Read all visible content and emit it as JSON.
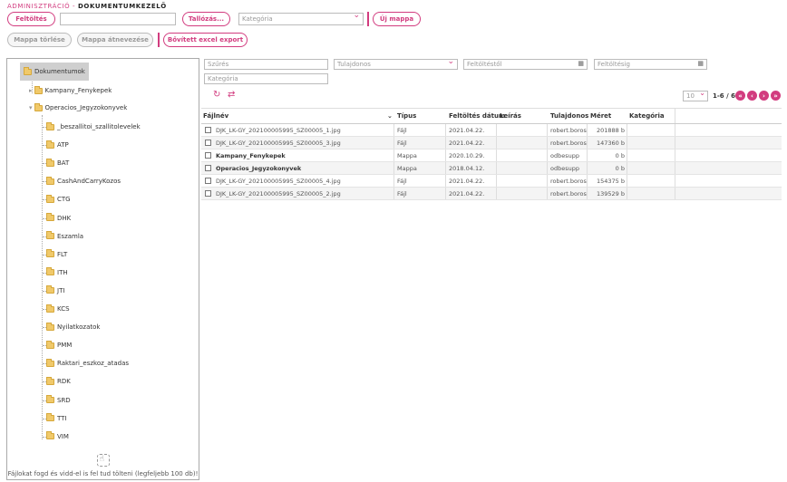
{
  "breadcrumb": {
    "section": "ADMINISZTRÁCIÓ",
    "sep": " - ",
    "page": "DOKUMENTUMKEZELŐ"
  },
  "toolbar": {
    "upload_label": "Feltöltés",
    "browse_label": "Tallózás...",
    "category_placeholder": "Kategória",
    "new_folder_label": "Új mappa",
    "delete_folder_label": "Mappa törlése",
    "rename_folder_label": "Mappa átnevezése",
    "excel_export_label": "Bővített excel export"
  },
  "filters": {
    "search_placeholder": "Szűrés",
    "owner_placeholder": "Tulajdonos",
    "upload_from_placeholder": "Feltöltéstől",
    "upload_to_placeholder": "Feltöltésig",
    "category_placeholder": "Kategória"
  },
  "tree": {
    "root": "Dokumentumok",
    "level1": [
      "Kampany_Fenykepek",
      "Operacios_Jegyzokonyvek"
    ],
    "children": [
      "_beszallitoi_szallitolevelek",
      "ATP",
      "BAT",
      "CashAndCarryKozos",
      "CTG",
      "DHK",
      "Eszamla",
      "FLT",
      "ITH",
      "JTI",
      "KCS",
      "Nyilatkozatok",
      "PMM",
      "Raktari_eszkoz_atadas",
      "RDK",
      "SRD",
      "TTI",
      "VIM"
    ],
    "drop_hint": "Fájlokat fogd és vidd-el is fel tud tölteni (legfeljebb 100 db)!"
  },
  "pager": {
    "page_size": "10",
    "range": "1-6 / 6"
  },
  "grid": {
    "columns": {
      "name": "Fájlnév",
      "type": "Típus",
      "date": "Feltöltés dátum",
      "desc": "Leírás",
      "owner": "Tulajdonos",
      "size": "Méret",
      "category": "Kategória"
    },
    "rows": [
      {
        "name": "DJK_LK-GY_202100005995_SZ00005_1.jpg",
        "type": "Fájl",
        "date": "2021.04.22.",
        "desc": "",
        "owner": "robert.boros",
        "size": "201888 b",
        "category": "",
        "folder": false
      },
      {
        "name": "DJK_LK-GY_202100005995_SZ00005_3.jpg",
        "type": "Fájl",
        "date": "2021.04.22.",
        "desc": "",
        "owner": "robert.boros",
        "size": "147360 b",
        "category": "",
        "folder": false
      },
      {
        "name": "Kampany_Fenykepek",
        "type": "Mappa",
        "date": "2020.10.29.",
        "desc": "",
        "owner": "odbesupp",
        "size": "0 b",
        "category": "",
        "folder": true
      },
      {
        "name": "Operacios_Jegyzokonyvek",
        "type": "Mappa",
        "date": "2018.04.12.",
        "desc": "",
        "owner": "odbesupp",
        "size": "0 b",
        "category": "",
        "folder": true
      },
      {
        "name": "DJK_LK-GY_202100005995_SZ00005_4.jpg",
        "type": "Fájl",
        "date": "2021.04.22.",
        "desc": "",
        "owner": "robert.boros",
        "size": "154375 b",
        "category": "",
        "folder": false
      },
      {
        "name": "DJK_LK-GY_202100005995_SZ00005_2.jpg",
        "type": "Fájl",
        "date": "2021.04.22.",
        "desc": "",
        "owner": "robert.boros",
        "size": "139529 b",
        "category": "",
        "folder": false
      }
    ]
  },
  "colors": {
    "accent": "#d23c7f",
    "folder": "#f0c96a"
  }
}
